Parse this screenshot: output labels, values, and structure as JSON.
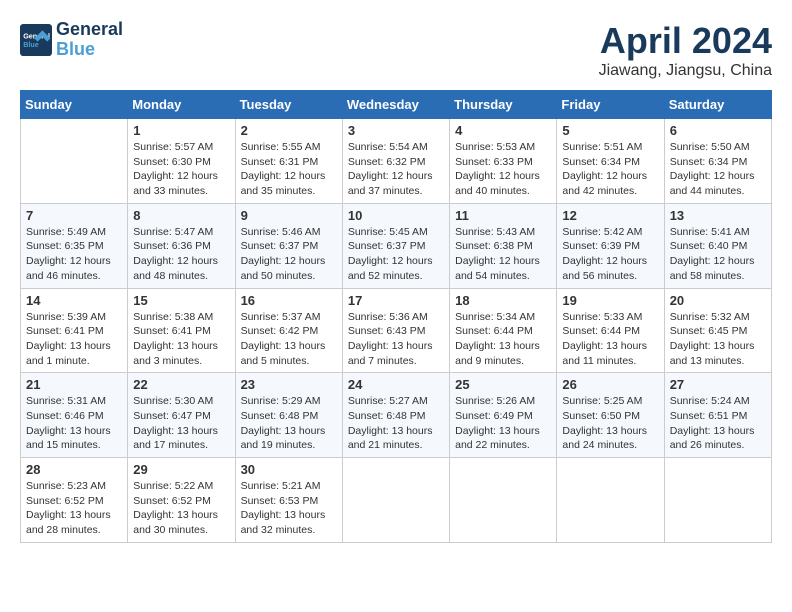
{
  "header": {
    "logo_line1": "General",
    "logo_line2": "Blue",
    "title": "April 2024",
    "location": "Jiawang, Jiangsu, China"
  },
  "columns": [
    "Sunday",
    "Monday",
    "Tuesday",
    "Wednesday",
    "Thursday",
    "Friday",
    "Saturday"
  ],
  "weeks": [
    [
      {
        "day": "",
        "content": ""
      },
      {
        "day": "1",
        "content": "Sunrise: 5:57 AM\nSunset: 6:30 PM\nDaylight: 12 hours\nand 33 minutes."
      },
      {
        "day": "2",
        "content": "Sunrise: 5:55 AM\nSunset: 6:31 PM\nDaylight: 12 hours\nand 35 minutes."
      },
      {
        "day": "3",
        "content": "Sunrise: 5:54 AM\nSunset: 6:32 PM\nDaylight: 12 hours\nand 37 minutes."
      },
      {
        "day": "4",
        "content": "Sunrise: 5:53 AM\nSunset: 6:33 PM\nDaylight: 12 hours\nand 40 minutes."
      },
      {
        "day": "5",
        "content": "Sunrise: 5:51 AM\nSunset: 6:34 PM\nDaylight: 12 hours\nand 42 minutes."
      },
      {
        "day": "6",
        "content": "Sunrise: 5:50 AM\nSunset: 6:34 PM\nDaylight: 12 hours\nand 44 minutes."
      }
    ],
    [
      {
        "day": "7",
        "content": "Sunrise: 5:49 AM\nSunset: 6:35 PM\nDaylight: 12 hours\nand 46 minutes."
      },
      {
        "day": "8",
        "content": "Sunrise: 5:47 AM\nSunset: 6:36 PM\nDaylight: 12 hours\nand 48 minutes."
      },
      {
        "day": "9",
        "content": "Sunrise: 5:46 AM\nSunset: 6:37 PM\nDaylight: 12 hours\nand 50 minutes."
      },
      {
        "day": "10",
        "content": "Sunrise: 5:45 AM\nSunset: 6:37 PM\nDaylight: 12 hours\nand 52 minutes."
      },
      {
        "day": "11",
        "content": "Sunrise: 5:43 AM\nSunset: 6:38 PM\nDaylight: 12 hours\nand 54 minutes."
      },
      {
        "day": "12",
        "content": "Sunrise: 5:42 AM\nSunset: 6:39 PM\nDaylight: 12 hours\nand 56 minutes."
      },
      {
        "day": "13",
        "content": "Sunrise: 5:41 AM\nSunset: 6:40 PM\nDaylight: 12 hours\nand 58 minutes."
      }
    ],
    [
      {
        "day": "14",
        "content": "Sunrise: 5:39 AM\nSunset: 6:41 PM\nDaylight: 13 hours\nand 1 minute."
      },
      {
        "day": "15",
        "content": "Sunrise: 5:38 AM\nSunset: 6:41 PM\nDaylight: 13 hours\nand 3 minutes."
      },
      {
        "day": "16",
        "content": "Sunrise: 5:37 AM\nSunset: 6:42 PM\nDaylight: 13 hours\nand 5 minutes."
      },
      {
        "day": "17",
        "content": "Sunrise: 5:36 AM\nSunset: 6:43 PM\nDaylight: 13 hours\nand 7 minutes."
      },
      {
        "day": "18",
        "content": "Sunrise: 5:34 AM\nSunset: 6:44 PM\nDaylight: 13 hours\nand 9 minutes."
      },
      {
        "day": "19",
        "content": "Sunrise: 5:33 AM\nSunset: 6:44 PM\nDaylight: 13 hours\nand 11 minutes."
      },
      {
        "day": "20",
        "content": "Sunrise: 5:32 AM\nSunset: 6:45 PM\nDaylight: 13 hours\nand 13 minutes."
      }
    ],
    [
      {
        "day": "21",
        "content": "Sunrise: 5:31 AM\nSunset: 6:46 PM\nDaylight: 13 hours\nand 15 minutes."
      },
      {
        "day": "22",
        "content": "Sunrise: 5:30 AM\nSunset: 6:47 PM\nDaylight: 13 hours\nand 17 minutes."
      },
      {
        "day": "23",
        "content": "Sunrise: 5:29 AM\nSunset: 6:48 PM\nDaylight: 13 hours\nand 19 minutes."
      },
      {
        "day": "24",
        "content": "Sunrise: 5:27 AM\nSunset: 6:48 PM\nDaylight: 13 hours\nand 21 minutes."
      },
      {
        "day": "25",
        "content": "Sunrise: 5:26 AM\nSunset: 6:49 PM\nDaylight: 13 hours\nand 22 minutes."
      },
      {
        "day": "26",
        "content": "Sunrise: 5:25 AM\nSunset: 6:50 PM\nDaylight: 13 hours\nand 24 minutes."
      },
      {
        "day": "27",
        "content": "Sunrise: 5:24 AM\nSunset: 6:51 PM\nDaylight: 13 hours\nand 26 minutes."
      }
    ],
    [
      {
        "day": "28",
        "content": "Sunrise: 5:23 AM\nSunset: 6:52 PM\nDaylight: 13 hours\nand 28 minutes."
      },
      {
        "day": "29",
        "content": "Sunrise: 5:22 AM\nSunset: 6:52 PM\nDaylight: 13 hours\nand 30 minutes."
      },
      {
        "day": "30",
        "content": "Sunrise: 5:21 AM\nSunset: 6:53 PM\nDaylight: 13 hours\nand 32 minutes."
      },
      {
        "day": "",
        "content": ""
      },
      {
        "day": "",
        "content": ""
      },
      {
        "day": "",
        "content": ""
      },
      {
        "day": "",
        "content": ""
      }
    ]
  ]
}
